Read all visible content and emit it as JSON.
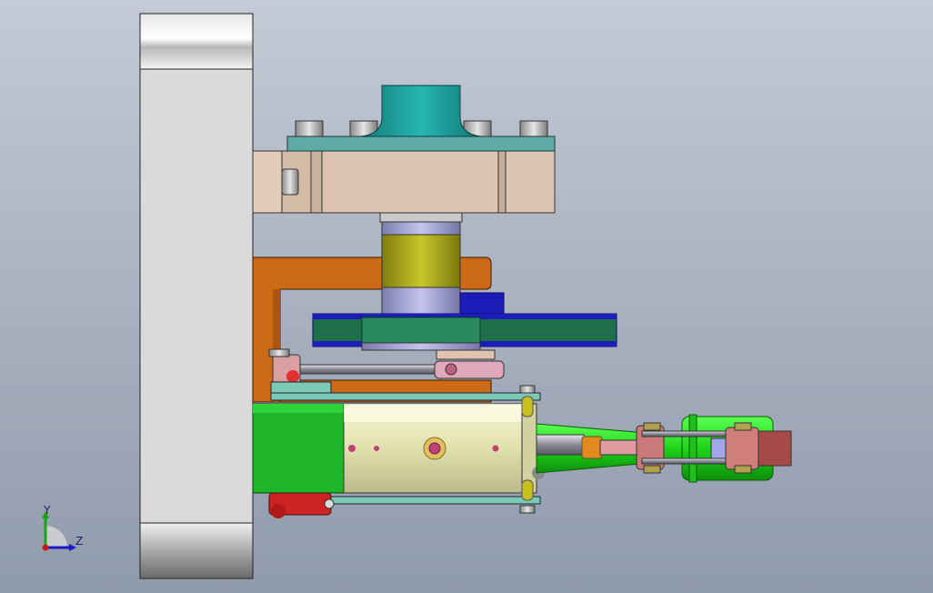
{
  "viewport": {
    "background_top": "#c4cad6",
    "background_bottom": "#8f9aab"
  },
  "triad": {
    "y_label": "Y",
    "z_label": "Z",
    "y_color": "#1aa31a",
    "z_color": "#1a1acc",
    "origin_color": "#cc1a1a"
  },
  "colors": {
    "frame_plate": "#d8d8d8",
    "flange": "#5fa9a6",
    "hub": "#1c9d9b",
    "housing": "#dcc4b0",
    "shaft_yellow": "#a9a61c",
    "shaft_lavender": "#a7a7d9",
    "bracket_orange": "#cc6a17",
    "belt_green": "#1f6f4a",
    "belt_blue": "#1c1cb8",
    "cylinder_body": "#e6e6b8",
    "cylinder_block": "#1fb52a",
    "rod_green": "#22d41f",
    "clevis_pink": "#c97a78",
    "plate_teal": "#7ccab6"
  }
}
